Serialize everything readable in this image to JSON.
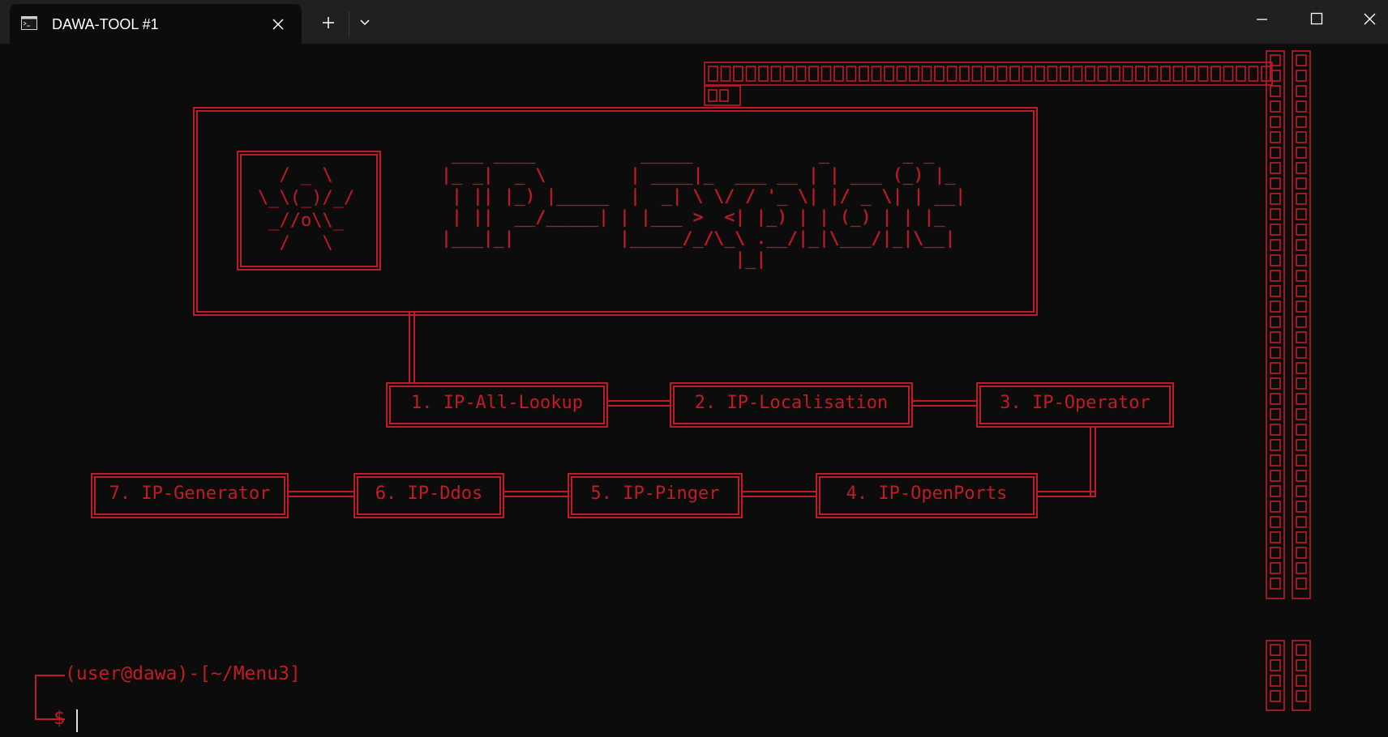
{
  "window": {
    "tab_title": "DAWA-TOOL #1",
    "icons": {
      "tab": "terminal-icon",
      "close_tab": "close-icon",
      "new_tab": "plus-icon",
      "dropdown": "chevron-down-icon",
      "minimize": "minimize-icon",
      "maximize": "maximize-icon",
      "close": "close-icon"
    }
  },
  "theme": {
    "background": "#0c0c0c",
    "accent": "#c01c28",
    "titlebar": "#202020"
  },
  "logo": {
    "skull_art": "  / _ \\\n\\_\\(_)/_/\n _//o\\\\_\n  /   \\",
    "title_art": " ___ ____          _____            _       _ _\n|_ _|  _ \\        | ____|_  ___ __ | | ___ (_) |_\n | || |_) |_____  |  _| \\ \\/ / '_ \\| |/ _ \\| | __|\n | ||  __/_____| | |___ >  <| |_) | | (_) | | |_\n|___|_|          |_____/_/\\_\\ .__/|_|\\___/|_|\\__|\n                            |_|"
  },
  "menu": {
    "item1": "1. IP-All-Lookup",
    "item2": "2. IP-Localisation",
    "item3": "3. IP-Operator",
    "item4": "4. IP-OpenPorts",
    "item5": "5. IP-Pinger",
    "item6": "6. IP-Ddos",
    "item7": "7. IP-Generator"
  },
  "prompt": {
    "context": "(user@dawa)-[~/Menu3]",
    "symbol": "$"
  }
}
